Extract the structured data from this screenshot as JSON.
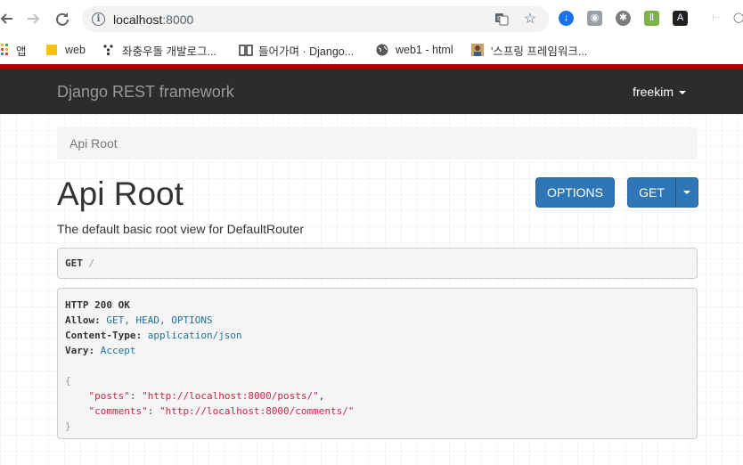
{
  "browser": {
    "url_host": "localhost",
    "url_port": ":8000",
    "icons": {
      "back": "back-arrow-icon",
      "forward": "forward-arrow-icon",
      "reload": "reload-icon",
      "info": "info-icon",
      "translate": "translate-icon",
      "star": "star-icon"
    }
  },
  "bookmarks": [
    {
      "label": "앱",
      "icon": "apps-grid-icon"
    },
    {
      "label": "web",
      "icon": "folder-icon"
    },
    {
      "label": "좌충우돌 개발로그...",
      "icon": "dots-icon"
    },
    {
      "label": "들어가며 · Django...",
      "icon": "book-icon"
    },
    {
      "label": "web1 - html",
      "icon": "globe-icon"
    },
    {
      "label": "'스프링 프레임워크...",
      "icon": "avatar-icon"
    }
  ],
  "navbar": {
    "brand": "Django REST framework",
    "user": "freekim"
  },
  "breadcrumb": "Api Root",
  "page": {
    "title": "Api Root",
    "description": "The default basic root view for DefaultRouter",
    "options_button": "OPTIONS",
    "get_button": "GET"
  },
  "request": {
    "method": "GET",
    "path": "/"
  },
  "response": {
    "status": "HTTP 200 OK",
    "allow_key": "Allow:",
    "allow_value": "GET, HEAD, OPTIONS",
    "content_type_key": "Content-Type:",
    "content_type_value": "application/json",
    "vary_key": "Vary:",
    "vary_value": "Accept",
    "open_brace": "{",
    "close_brace": "}",
    "body": [
      {
        "key": "\"posts\"",
        "value": "\"http://localhost:8000/posts/\"",
        "sep": ","
      },
      {
        "key": "\"comments\"",
        "value": "\"http://localhost:8000/comments/\"",
        "sep": ""
      }
    ]
  },
  "colors": {
    "navbar": "#2c2c2c",
    "accent_red": "#a30000",
    "button_blue": "#2f76b7",
    "json_string": "#c7254e"
  }
}
